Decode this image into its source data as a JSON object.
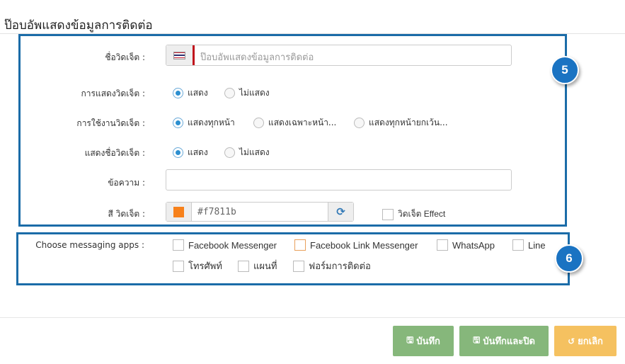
{
  "page": {
    "title": "ป๊อบอัพแสดงข้อมูลการติดต่อ"
  },
  "markers": {
    "m5": "5",
    "m6": "6"
  },
  "form": {
    "widget_name": {
      "label": "ชื่อวิดเจ็ต :",
      "placeholder": "ป๊อบอัพแสดงข้อมูลการติดต่อ",
      "flag_icon": "thailand-flag-icon"
    },
    "display_widget": {
      "label": "การแสดงวิดเจ็ต :",
      "options": [
        "แสดง",
        "ไม่แสดง"
      ],
      "selected": "แสดง"
    },
    "widget_usage": {
      "label": "การใช้งานวิดเจ็ต :",
      "options": [
        "แสดงทุกหน้า",
        "แสดงเฉพาะหน้า...",
        "แสดงทุกหน้ายกเว้น..."
      ],
      "selected": "แสดงทุกหน้า"
    },
    "show_widget_name": {
      "label": "แสดงชื่อวิดเจ็ต :",
      "options": [
        "แสดง",
        "ไม่แสดง"
      ],
      "selected": "แสดง"
    },
    "message": {
      "label": "ข้อความ :",
      "value": ""
    },
    "widget_color": {
      "label": "สี วิดเจ็ต :",
      "value": "#f7811b",
      "swatch_color": "#f7811b"
    },
    "widget_effect": {
      "label": "วิดเจ็ต Effect",
      "checked": false
    }
  },
  "messaging": {
    "label": "Choose messaging apps :",
    "apps": [
      {
        "label": "Facebook Messenger",
        "checked": false
      },
      {
        "label": "Facebook Link Messenger",
        "checked": false
      },
      {
        "label": "WhatsApp",
        "checked": false
      },
      {
        "label": "Line",
        "checked": false
      },
      {
        "label": "โทรศัพท์",
        "checked": false
      },
      {
        "label": "แผนที่",
        "checked": false
      },
      {
        "label": "ฟอร์มการติดต่อ",
        "checked": false
      }
    ]
  },
  "footer": {
    "save": "บันทึก",
    "save_close": "บันทึกและปิด",
    "cancel": "ยกเลิก",
    "colors": {
      "save": "#86b77b",
      "cancel": "#f5c160"
    }
  },
  "accent": {
    "annotation_border": "#1b6ca8",
    "marker": "#1a73c2"
  }
}
